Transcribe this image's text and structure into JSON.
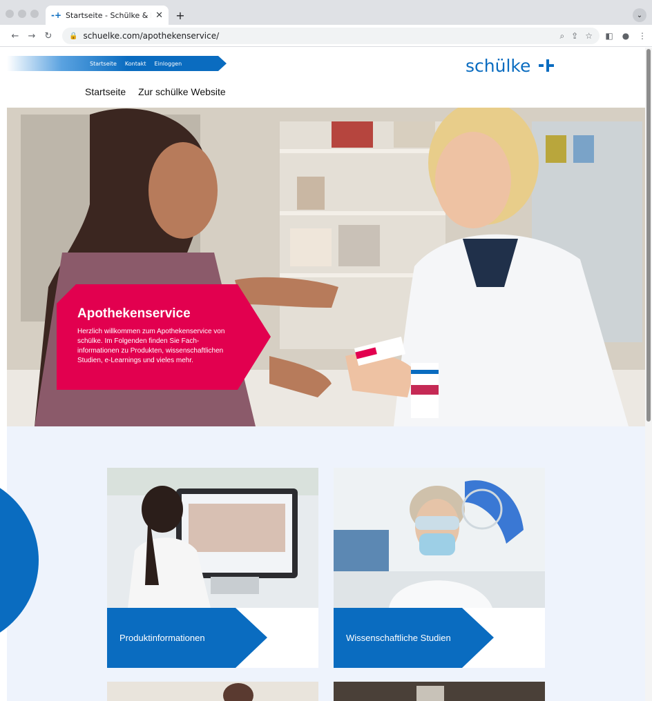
{
  "browser": {
    "tab_title": "Startseite - Schülke & Mayr G",
    "url": "schuelke.com/apothekenservice/"
  },
  "site": {
    "meta_links": [
      "Startseite",
      "Kontakt",
      "Einloggen"
    ],
    "logo_text": "schülke",
    "main_nav": [
      "Startseite",
      "Zur schülke Website"
    ]
  },
  "hero": {
    "heading": "Apothekenservice",
    "text": "Herzlich willkommen zum Apothekenservice von schülke. Im Folgenden finden Sie Fach­informationen zu Produkten, wissenschaft­lichen Studien, e-Learnings und vieles mehr."
  },
  "cards": [
    {
      "label": "Produktinformationen"
    },
    {
      "label": "Wissenschaftliche Studien"
    }
  ],
  "colors": {
    "brand_blue": "#0a6cc0",
    "hero_pink": "#e2004f",
    "content_bg": "#eef3fc"
  }
}
